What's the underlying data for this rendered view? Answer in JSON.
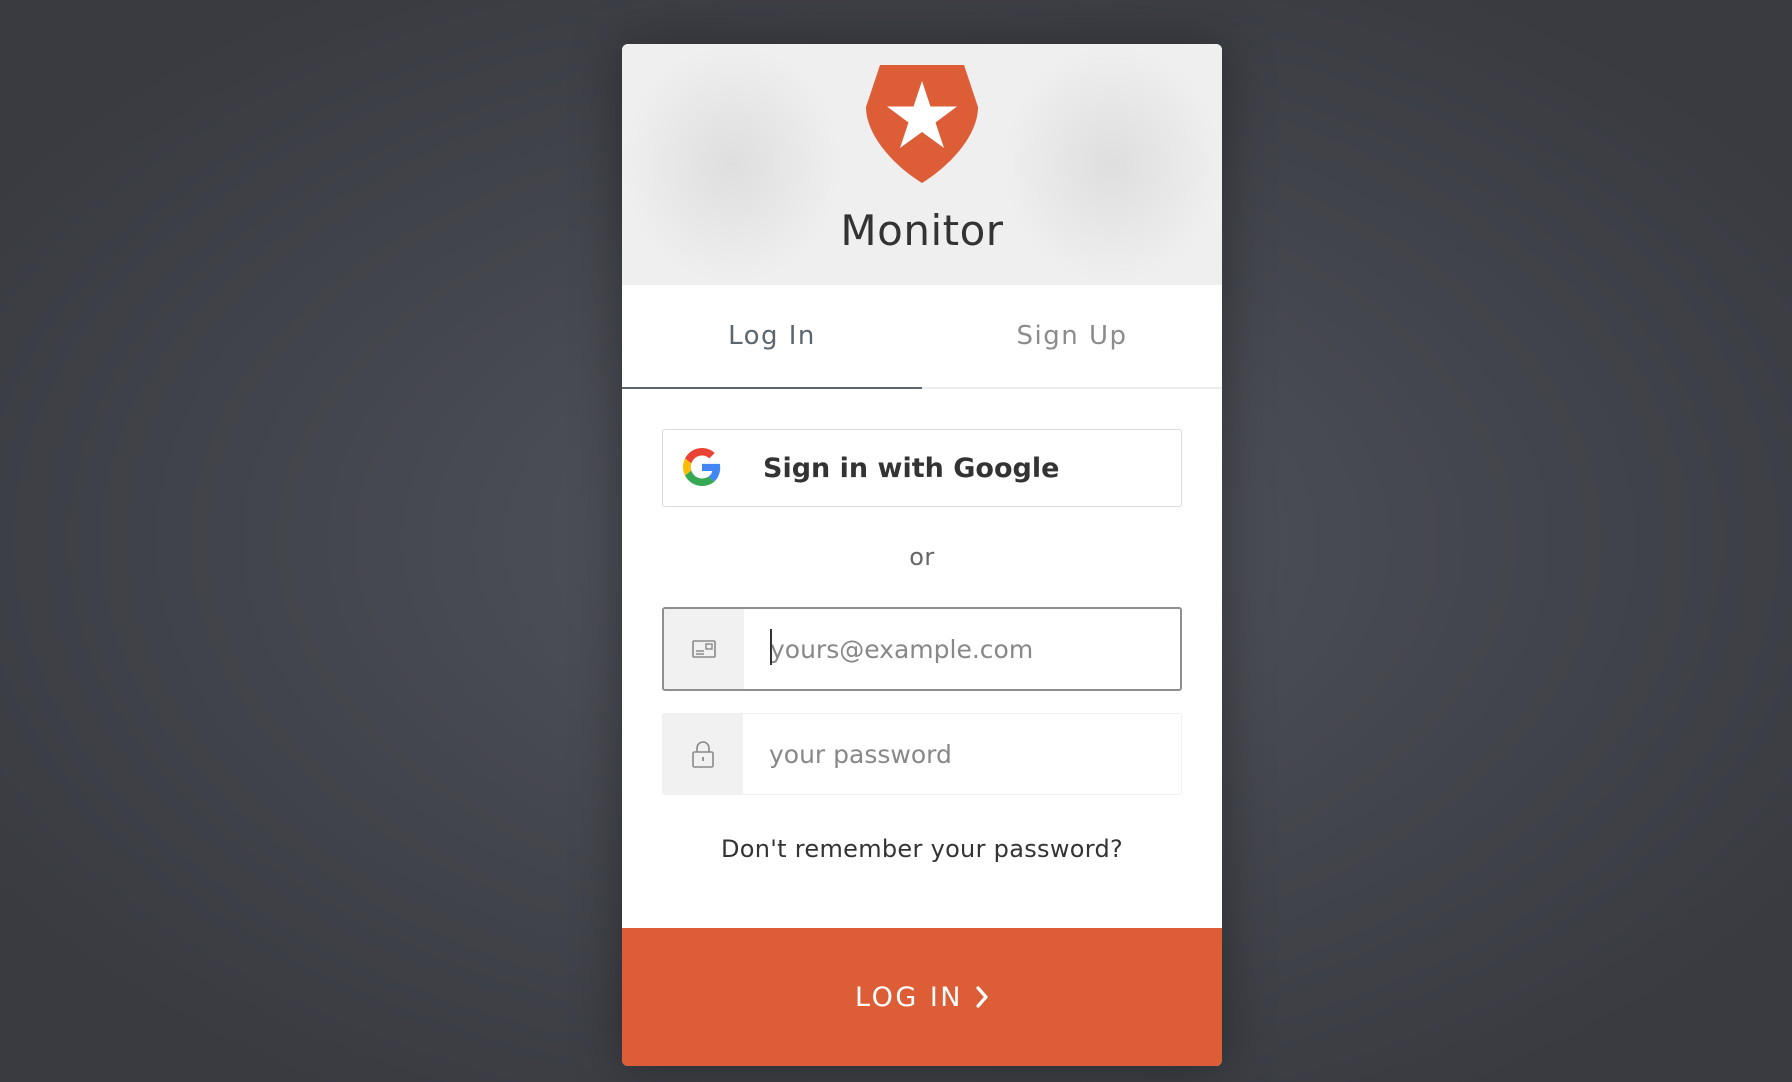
{
  "app": {
    "title": "Monitor"
  },
  "tabs": [
    {
      "label": "Log In",
      "active": true
    },
    {
      "label": "Sign Up",
      "active": false
    }
  ],
  "social": {
    "google_label": "Sign in with Google"
  },
  "separator_text": "or",
  "fields": {
    "email": {
      "placeholder": "yours@example.com",
      "value": "",
      "icon": "email-card-icon"
    },
    "password": {
      "placeholder": "your password",
      "value": "",
      "icon": "lock-icon"
    }
  },
  "forgot_password_text": "Don't remember your password?",
  "submit": {
    "label": "LOG IN",
    "icon": "chevron-right-icon"
  },
  "colors": {
    "accent": "#dd5d37",
    "background": "#44464d",
    "header_bg": "#efefef",
    "active_tab": "#5c666f"
  }
}
